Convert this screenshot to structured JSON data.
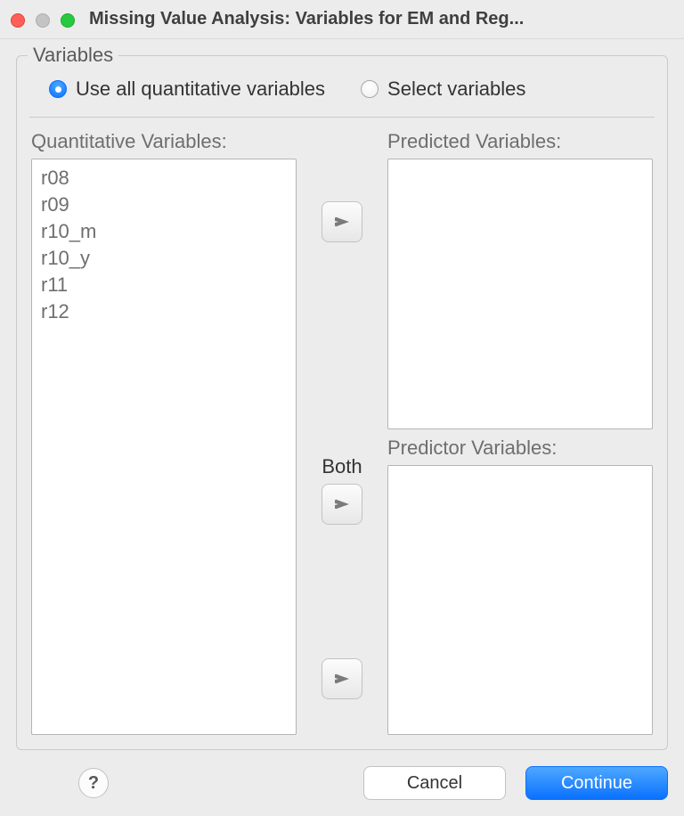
{
  "window": {
    "title": "Missing Value Analysis: Variables for EM and Reg..."
  },
  "group": {
    "title": "Variables",
    "radio_useAll": "Use all quantitative variables",
    "radio_select": "Select variables",
    "selected": "useAll"
  },
  "labels": {
    "quantitative": "Quantitative Variables:",
    "predicted": "Predicted Variables:",
    "predictor": "Predictor Variables:",
    "both": "Both"
  },
  "quantitative_vars": [
    "r08",
    "r09",
    "r10_m",
    "r10_y",
    "r11",
    "r12"
  ],
  "predicted_vars": [],
  "predictor_vars": [],
  "buttons": {
    "help": "?",
    "cancel": "Cancel",
    "continue": "Continue"
  }
}
